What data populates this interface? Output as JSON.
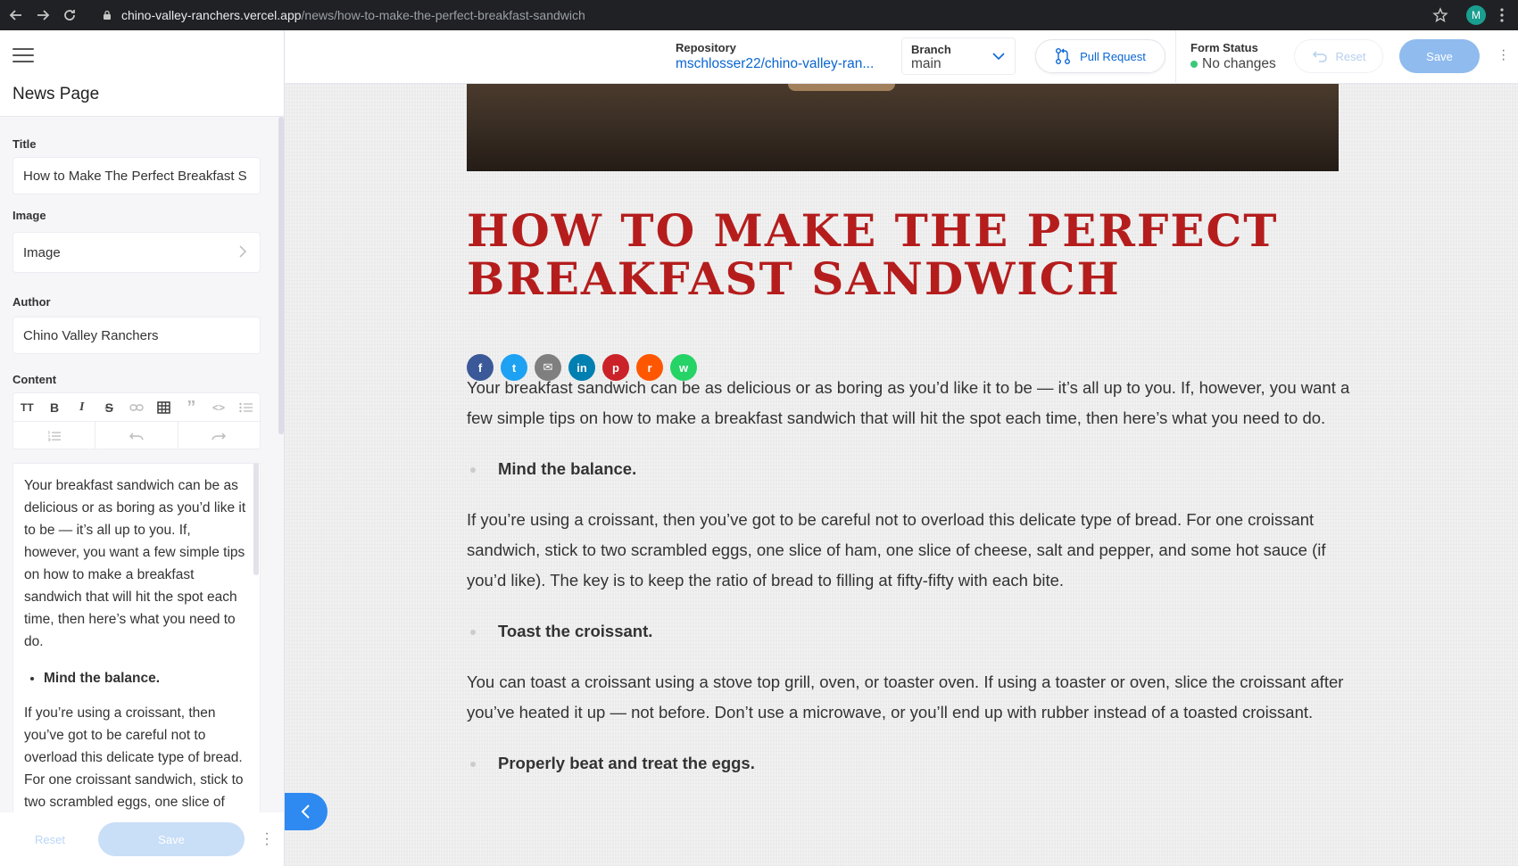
{
  "browser": {
    "url_host": "chino-valley-ranchers.vercel.app",
    "url_path": "/news/how-to-make-the-perfect-breakfast-sandwich",
    "avatar_letter": "M"
  },
  "sidebar": {
    "title": "News Page",
    "fields": {
      "title_label": "Title",
      "title_value": "How to Make The Perfect Breakfast S",
      "image_label": "Image",
      "image_value": "Image",
      "author_label": "Author",
      "author_value": "Chino Valley Ranchers",
      "content_label": "Content"
    },
    "toolbar": {
      "heading": "TT",
      "bold": "B",
      "italic": "I",
      "quote": "”",
      "code": "<>"
    },
    "editor": {
      "para1": "Your breakfast sandwich can be as delicious or as boring as you’d like it to be — it’s all up to you. If, however, you want a few simple tips on how to make a breakfast sandwich that will hit the spot each time, then here’s what you need to do.",
      "bullet1": "Mind the balance.",
      "para2": "If you’re using a croissant, then you’ve got to be careful not to overload this delicate type of bread. For one croissant sandwich, stick to two scrambled eggs, one slice of ham, one slice of cheese, salt and pepper, and some hot sauce (if you’d like)."
    },
    "footer": {
      "reset": "Reset",
      "save": "Save"
    }
  },
  "topbar": {
    "repo_label": "Repository",
    "repo_value": "mschlosser22/chino-valley-ran...",
    "branch_label": "Branch",
    "branch_value": "main",
    "pr_label": "Pull Request",
    "status_label": "Form Status",
    "status_value": "No changes",
    "status_color": "#3cc77a",
    "reset_label": "Reset",
    "save_label": "Save"
  },
  "article": {
    "title": "HOW TO MAKE THE PERFECT BREAKFAST SANDWICH",
    "share_icons": [
      {
        "name": "facebook-icon",
        "glyph": "f",
        "color": "#3b5998"
      },
      {
        "name": "twitter-icon",
        "glyph": "t",
        "color": "#1da1f2"
      },
      {
        "name": "email-icon",
        "glyph": "✉",
        "color": "#7f7f7f"
      },
      {
        "name": "linkedin-icon",
        "glyph": "in",
        "color": "#007fb1"
      },
      {
        "name": "pinterest-icon",
        "glyph": "p",
        "color": "#cb2128"
      },
      {
        "name": "reddit-icon",
        "glyph": "r",
        "color": "#ff5700"
      },
      {
        "name": "whatsapp-icon",
        "glyph": "w",
        "color": "#25d366"
      }
    ],
    "p1": "Your breakfast sandwich can be as delicious or as boring as you’d like it to be — it’s all up to you. If, however, you want a few simple tips on how to make a breakfast sandwich that will hit the spot each time, then here’s what you need to do.",
    "b1": "Mind the balance.",
    "p2": "If you’re using a croissant, then you’ve got to be careful not to overload this delicate type of bread. For one croissant sandwich, stick to two scrambled eggs, one slice of ham, one slice of cheese, salt and pepper, and some hot sauce (if you’d like). The key is to keep the ratio of bread to filling at fifty-fifty with each bite.",
    "b2": "Toast the croissant.",
    "p3": "You can toast a croissant using a stove top grill, oven, or toaster oven. If using a toaster or oven, slice the croissant after you’ve heated it up — not before. Don’t use a microwave, or you’ll end up with rubber instead of a toasted croissant.",
    "b3": "Properly beat and treat the eggs."
  }
}
